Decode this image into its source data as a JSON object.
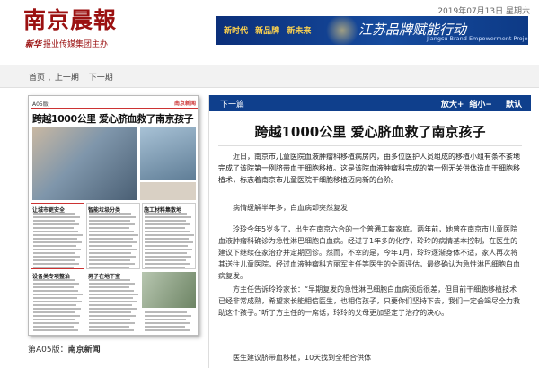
{
  "header": {
    "logo": "南京晨報",
    "brand": "新华",
    "sub": "报业传媒集团主办",
    "date": "2019年07月13日 星期六"
  },
  "banner": {
    "tags": [
      "新时代",
      "新品牌",
      "新未来"
    ],
    "title": "江苏品牌赋能行动",
    "en": "Jiangsu Brand Empowerment Project",
    "colors": {
      "bg": "#0b2f7a",
      "accent": "#ffd34d"
    }
  },
  "nav": {
    "home": "首页",
    "prev": "上一期",
    "next": "下一期"
  },
  "thumbnail": {
    "page_no": "A05版",
    "section_tag": "南京新闻",
    "headline": "跨越1000公里 爱心脐血救了南京孩子",
    "subheads": [
      "让城市更安全",
      "智能垃圾分类",
      "施工材料集散地",
      "设备类专项整治",
      "男子在地下室"
    ]
  },
  "page_label": {
    "page": "第A05版：",
    "name": "南京新闻"
  },
  "toolbar": {
    "next": "下一篇",
    "zoom_in": "放大+",
    "zoom_out": "缩小−",
    "reset": "默认"
  },
  "article": {
    "title": "跨越1000公里 爱心脐血救了南京孩子",
    "paragraphs": [
      "近日，南京市儿童医院血液肿瘤科移植病房内，由多位医护人员组成的移植小组有条不紊地完成了该院第一例脐带血干细胞移植。这是该院血液肿瘤科完成的第一例无关供体造血干细胞移植术，标志着南京市儿童医院干细胞移植迈向新的台阶。",
      "病情缓解半年多，白血病却突然复发",
      "玲玲今年5岁多了，出生在南京六合的一个普通工薪家庭。两年前，她曾在南京市儿童医院血液肿瘤科确诊为急性淋巴细胞白血病。经过了1年多的化疗，玲玲的病情基本控制，在医生的建议下继续在家治疗并定期回诊。然而，不幸的是，今年1月，玲玲逐渐身体不适，家人再次将其送往儿童医院，经过血液肿瘤科方丽军主任等医生的全面评估，最终确认为急性淋巴细胞白血病复发。",
      "方主任告诉玲玲家长：“早期复发的急性淋巴细胞白血病预后很差，但目前干细胞移植技术已经非常成熟，希望家长能相信医生，也相信孩子，只要你们坚持下去，我们一定会竭尽全力救助这个孩子。”听了方主任的一席话，玲玲的父母更加坚定了治疗的决心。",
      "医生建议脐带血移植，10天找到全相合供体"
    ]
  }
}
